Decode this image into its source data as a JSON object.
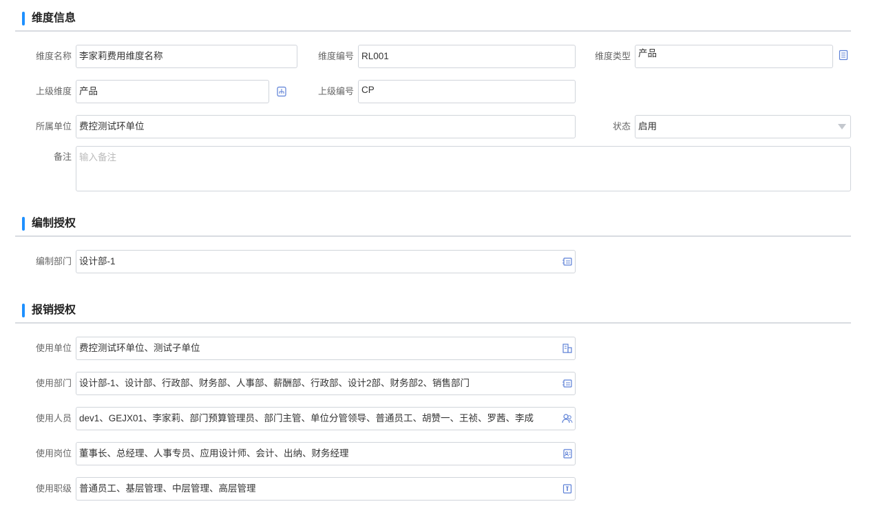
{
  "section_dimension": {
    "title": "维度信息",
    "name_label": "维度名称",
    "name_value": "李家莉费用维度名称",
    "code_label": "维度编号",
    "code_value": "RL001",
    "type_label": "维度类型",
    "type_value": "产品",
    "parent_label": "上级维度",
    "parent_value": "产品",
    "parent_code_label": "上级编号",
    "parent_code_value": "CP",
    "unit_label": "所属单位",
    "unit_value": "费控测试环单位",
    "status_label": "状态",
    "status_value": "启用",
    "remark_label": "备注",
    "remark_placeholder": "输入备注"
  },
  "section_edit_auth": {
    "title": "编制授权",
    "dept_label": "编制部门",
    "dept_value": "设计部-1"
  },
  "section_reimburse_auth": {
    "title": "报销授权",
    "unit_label": "使用单位",
    "unit_value": "费控测试环单位、测试子单位",
    "dept_label": "使用部门",
    "dept_value": "设计部-1、设计部、行政部、财务部、人事部、薪酬部、行政部、设计2部、财务部2、销售部门",
    "person_label": "使用人员",
    "person_value": "dev1、GEJX01、李家莉、部门预算管理员、部门主管、单位分管领导、普通员工、胡赞一、王祯、罗茜、李成",
    "post_label": "使用岗位",
    "post_value": "董事长、总经理、人事专员、应用设计师、会计、出纳、财务经理",
    "rank_label": "使用职级",
    "rank_value": "普通员工、基层管理、中层管理、高层管理"
  },
  "colors": {
    "accent": "#1e90ff",
    "icon": "#5b7fd6",
    "border": "#d0d4da"
  }
}
